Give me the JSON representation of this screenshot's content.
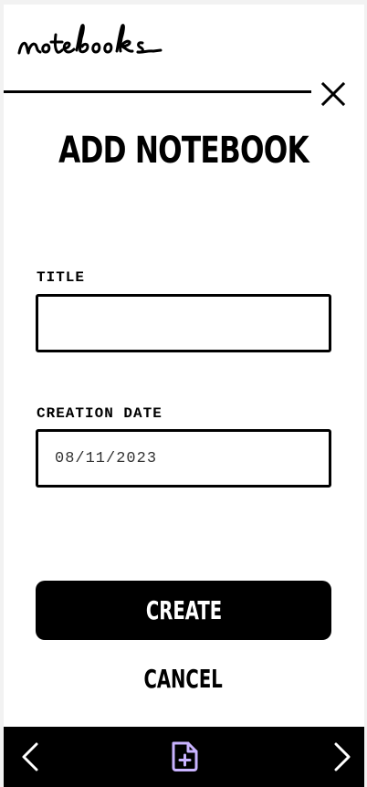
{
  "app": {
    "logo_text": "notebooks"
  },
  "dialog": {
    "title": "ADD NOTEBOOK",
    "fields": {
      "title": {
        "label": "TITLE",
        "value": "",
        "placeholder": ""
      },
      "creation_date": {
        "label": "CREATION DATE",
        "value": "08/11/2023"
      }
    },
    "create_label": "CREATE",
    "cancel_label": "CANCEL"
  },
  "icons": {
    "close": "close-icon",
    "prev": "chevron-left-icon",
    "new_file": "file-plus-icon",
    "next": "chevron-right-icon"
  },
  "colors": {
    "primary": "#000000",
    "accent": "#c9b3ff",
    "background": "#ffffff"
  }
}
